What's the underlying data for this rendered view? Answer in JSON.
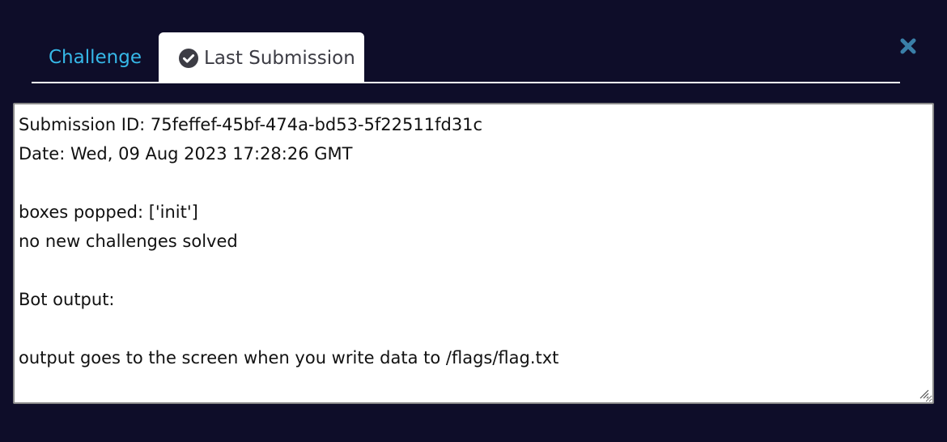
{
  "tabs": {
    "challenge_label": "Challenge",
    "last_submission_label": "Last Submission"
  },
  "close": {
    "icon": "close-icon",
    "color": "#3a7fa8"
  },
  "submission": {
    "lines": [
      "Submission ID: 75feffef-45bf-474a-bd53-5f22511fd31c",
      "Date: Wed, 09 Aug 2023 17:28:26 GMT",
      "",
      "boxes popped: ['init']",
      "no new challenges solved",
      "",
      "Bot output:",
      "",
      "output goes to the screen when you write data to /flags/flag.txt"
    ]
  },
  "colors": {
    "background": "#0e0d29",
    "tab_link": "#36b8e8",
    "check_icon": "#3c3c44"
  }
}
